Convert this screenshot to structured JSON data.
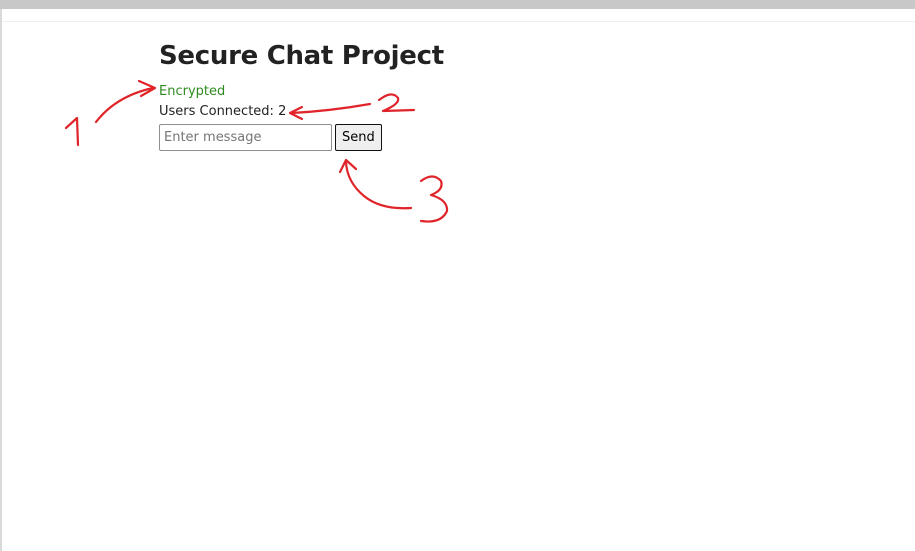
{
  "page": {
    "title": "Secure Chat Project",
    "status_text": "Encrypted",
    "users_label": "Users Connected:",
    "users_count": "2",
    "message_input": {
      "value": "",
      "placeholder": "Enter message"
    },
    "send_label": "Send"
  },
  "annotations": {
    "marker_1": "1",
    "marker_2": "2",
    "marker_3": "3",
    "color": "#e0242a"
  },
  "colors": {
    "status": "#2e8b1f",
    "text": "#222222",
    "background": "#ffffff"
  }
}
